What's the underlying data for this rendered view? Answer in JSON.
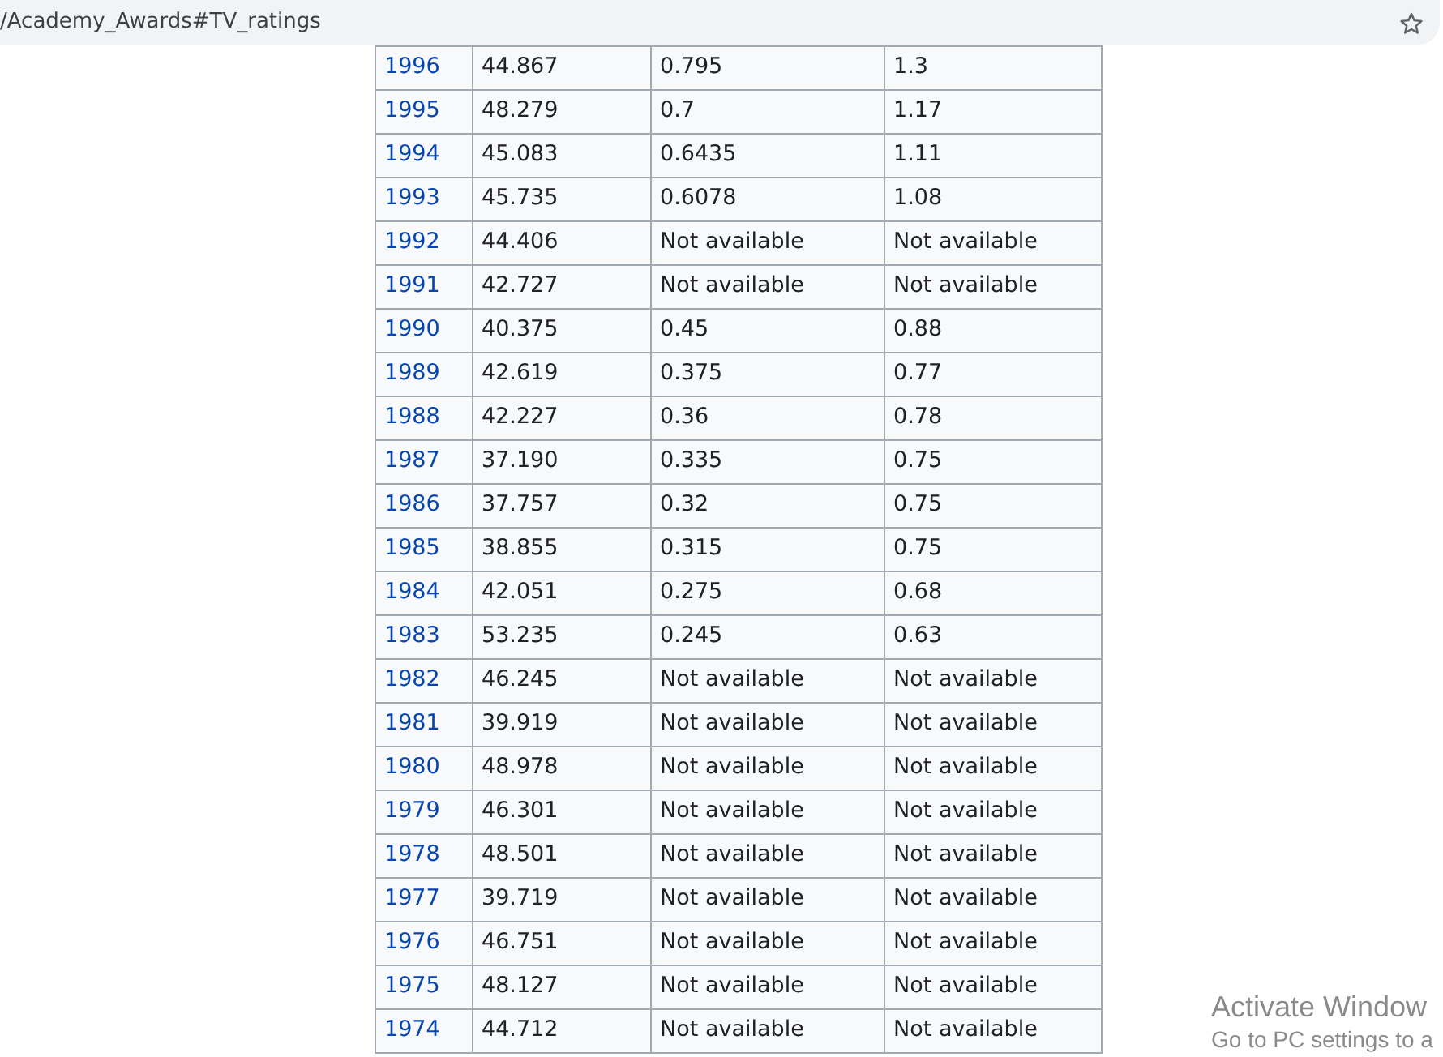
{
  "address_bar": {
    "url": "/Academy_Awards#TV_ratings"
  },
  "table": {
    "rows": [
      [
        "1996",
        "44.867",
        "0.795",
        "1.3"
      ],
      [
        "1995",
        "48.279",
        "0.7",
        "1.17"
      ],
      [
        "1994",
        "45.083",
        "0.6435",
        "1.11"
      ],
      [
        "1993",
        "45.735",
        "0.6078",
        "1.08"
      ],
      [
        "1992",
        "44.406",
        "Not available",
        "Not available"
      ],
      [
        "1991",
        "42.727",
        "Not available",
        "Not available"
      ],
      [
        "1990",
        "40.375",
        "0.45",
        "0.88"
      ],
      [
        "1989",
        "42.619",
        "0.375",
        "0.77"
      ],
      [
        "1988",
        "42.227",
        "0.36",
        "0.78"
      ],
      [
        "1987",
        "37.190",
        "0.335",
        "0.75"
      ],
      [
        "1986",
        "37.757",
        "0.32",
        "0.75"
      ],
      [
        "1985",
        "38.855",
        "0.315",
        "0.75"
      ],
      [
        "1984",
        "42.051",
        "0.275",
        "0.68"
      ],
      [
        "1983",
        "53.235",
        "0.245",
        "0.63"
      ],
      [
        "1982",
        "46.245",
        "Not available",
        "Not available"
      ],
      [
        "1981",
        "39.919",
        "Not available",
        "Not available"
      ],
      [
        "1980",
        "48.978",
        "Not available",
        "Not available"
      ],
      [
        "1979",
        "46.301",
        "Not available",
        "Not available"
      ],
      [
        "1978",
        "48.501",
        "Not available",
        "Not available"
      ],
      [
        "1977",
        "39.719",
        "Not available",
        "Not available"
      ],
      [
        "1976",
        "46.751",
        "Not available",
        "Not available"
      ],
      [
        "1975",
        "48.127",
        "Not available",
        "Not available"
      ],
      [
        "1974",
        "44.712",
        "Not available",
        "Not available"
      ]
    ]
  },
  "os_notice": {
    "title": "Activate Window",
    "subtitle": "Go to PC settings to a"
  }
}
